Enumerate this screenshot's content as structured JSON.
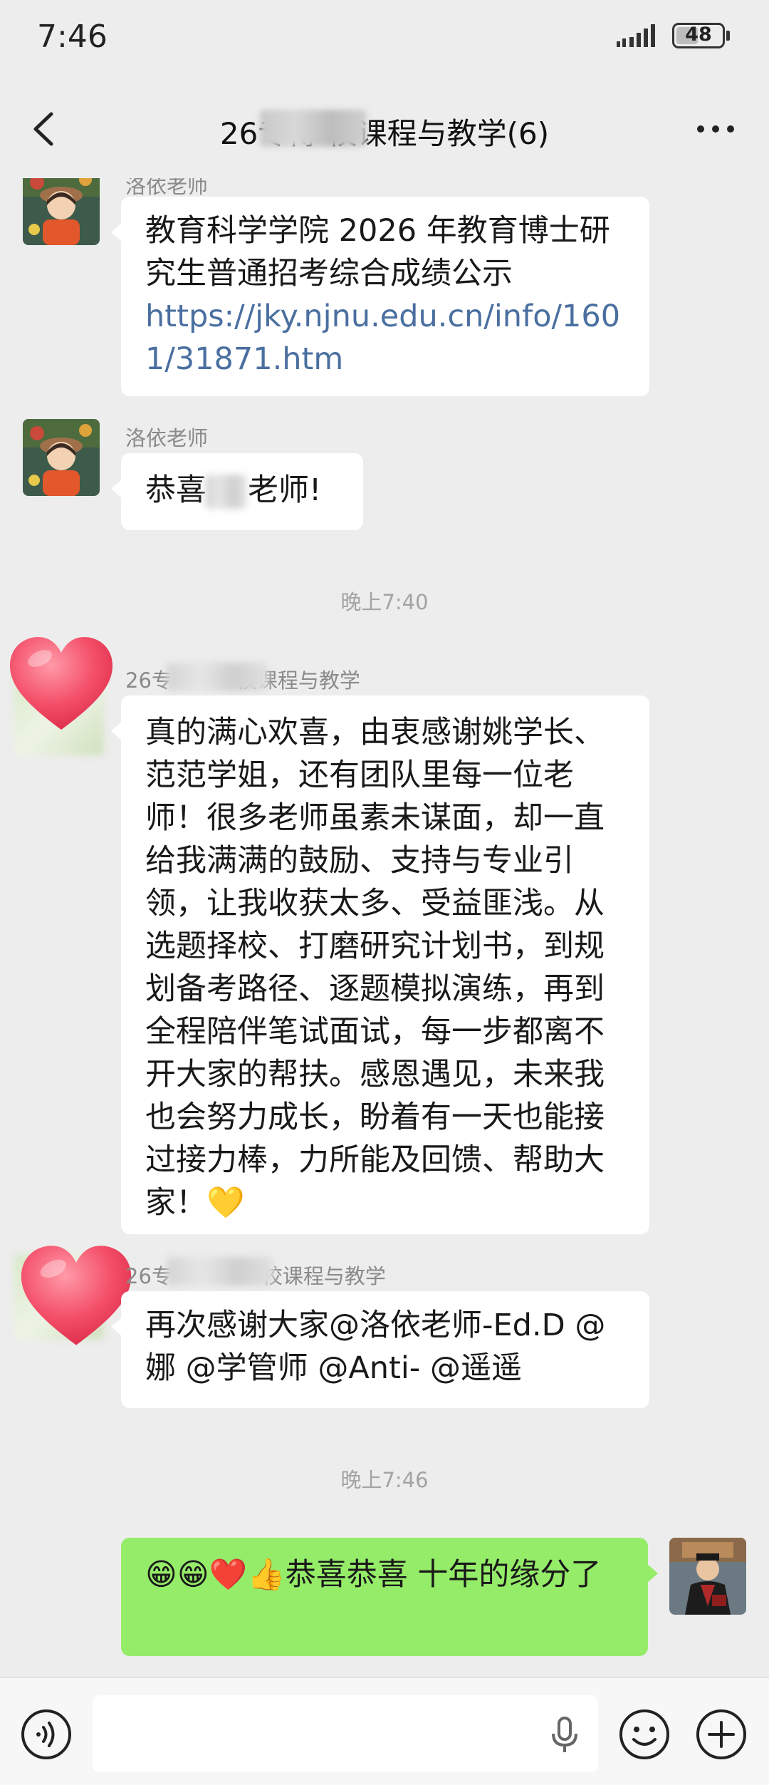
{
  "status_bar": {
    "time": "7:46",
    "battery": "48",
    "battery_level": 0.48
  },
  "header": {
    "title": "26专博  校课程与教学(6)"
  },
  "messages": [
    {
      "sender": "洛依老师",
      "text": "教育科学学院 2026 年教育博士研究生普通招考综合成绩公示",
      "link": "https://jky.njnu.edu.cn/info/1601/31871.htm"
    },
    {
      "sender": "洛依老师",
      "text_a": "恭喜",
      "text_b": "老师!"
    },
    {
      "time": "晚上7:40"
    },
    {
      "sender_a": "26专",
      "sender_b": "校课程与教学",
      "text": "真的满心欢喜，由衷感谢姚学长、范范学姐，还有团队里每一位老师！很多老师虽素未谋面，却一直给我满满的鼓励、支持与专业引领，让我收获太多、受益匪浅。从选题择校、打磨研究计划书，到规划备考路径、逐题模拟演练，再到全程陪伴笔试面试，每一步都离不开大家的帮扶。感恩遇见，未来我也会努力成长，盼着有一天也能接过接力棒，力所能及回馈、帮助大家！💛"
    },
    {
      "sender_a": "26专",
      "sender_b": "校课程与教学",
      "text": "再次感谢大家@洛依老师-Ed.D @娜 @学管师 @Anti- @遥遥"
    },
    {
      "time": "晚上7:46"
    },
    {
      "text": "😁😁❤️👍恭喜恭喜  十年的缘分了",
      "mine": true
    }
  ],
  "colors": {
    "background": "#ededed",
    "my_bubble": "#95ec69",
    "link": "#4a6fa0"
  }
}
